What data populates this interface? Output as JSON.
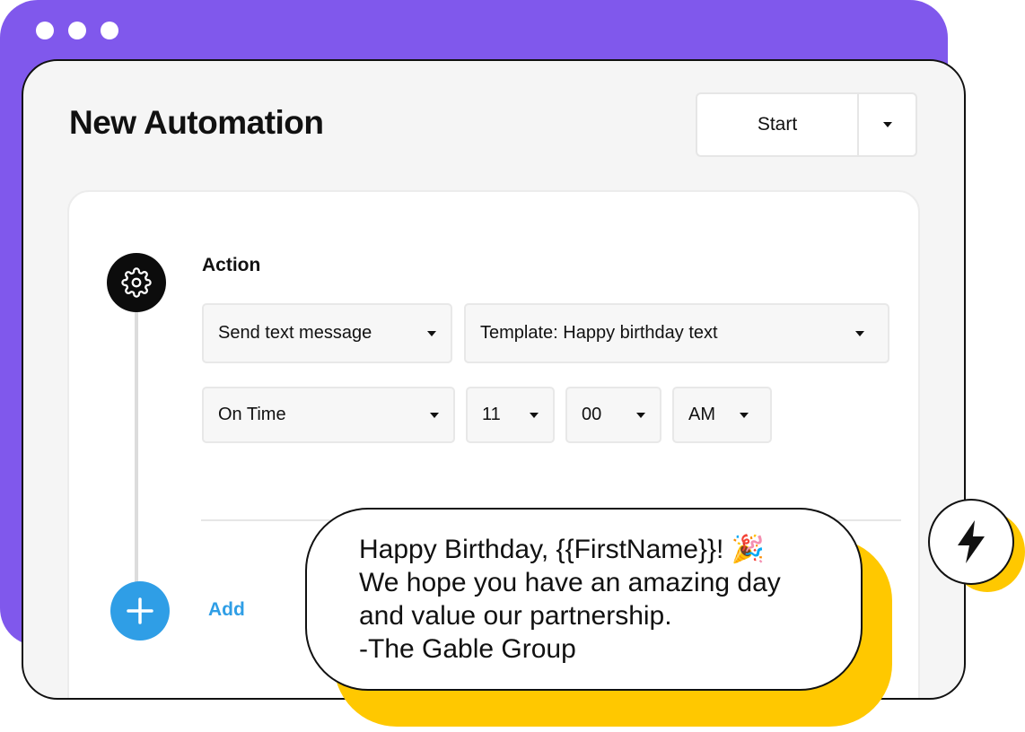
{
  "window": {
    "title": "New Automation"
  },
  "header": {
    "start_label": "Start"
  },
  "action": {
    "label": "Action",
    "type_select": "Send text message",
    "template_select": "Template: Happy birthday text",
    "timing_select": "On Time",
    "hour_select": "11",
    "minute_select": "00",
    "ampm_select": "AM"
  },
  "add": {
    "label": "Add"
  },
  "message": {
    "line1": "Happy Birthday, {{FirstName}}! 🎉",
    "line2": "We hope you have an amazing day",
    "line3": "and value our partnership.",
    "line4": "-The Gable Group"
  },
  "icons": {
    "window_controls": "window-dot-icon",
    "dropdown": "caret-down-icon",
    "step": "gear-icon",
    "add": "plus-icon",
    "badge": "lightning-bolt-icon"
  },
  "colors": {
    "accent_purple": "#8058ec",
    "accent_blue": "#2f9ee6",
    "accent_yellow": "#ffc800"
  }
}
